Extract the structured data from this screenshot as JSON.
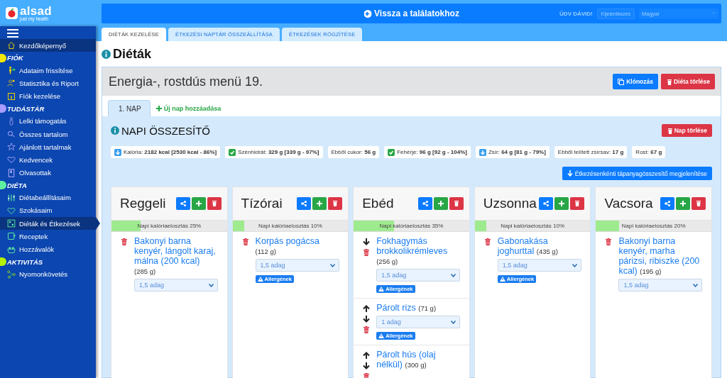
{
  "logo": {
    "name": "alsad",
    "tagline": "just my health"
  },
  "header": {
    "back_button": "Vissza a találatokhoz",
    "greeting": "ÜDV DÁVID!",
    "logout_button": "Kijelentkezés",
    "language": "Magyar"
  },
  "sidebar": {
    "items": [
      {
        "label": "Kezdőképernyő",
        "selected": false,
        "hover": true
      }
    ],
    "sections": [
      {
        "title": "FIÓK",
        "color": "#f5e800",
        "items": [
          {
            "label": "Adataim frissítése",
            "selected": false
          },
          {
            "label": "Statisztika és Riport",
            "selected": false
          },
          {
            "label": "Fiók kezelése",
            "selected": false
          }
        ]
      },
      {
        "title": "TUDÁSTÁR",
        "color": "#a99cff",
        "items": [
          {
            "label": "Lelki támogatás",
            "selected": false
          },
          {
            "label": "Összes tartalom",
            "selected": false
          },
          {
            "label": "Ajánlott tartalmak",
            "selected": false
          },
          {
            "label": "Kedvencek",
            "selected": false
          },
          {
            "label": "Olvasottak",
            "selected": false
          }
        ]
      },
      {
        "title": "DIÉTA",
        "color": "#5ef0a0",
        "items": [
          {
            "label": "Diétabeállításaim",
            "selected": false
          },
          {
            "label": "Szokásaim",
            "selected": false
          },
          {
            "label": "Diéták és Étkezések",
            "selected": true
          },
          {
            "label": "Receptek",
            "selected": false
          },
          {
            "label": "Hozzávalók",
            "selected": false
          }
        ]
      },
      {
        "title": "AKTIVITÁS",
        "color": "#b4f000",
        "items": [
          {
            "label": "Nyomonkövetés",
            "selected": false
          }
        ]
      }
    ]
  },
  "tabs": [
    {
      "label": "DIÉTÁK KEZELÉSE",
      "selected": true
    },
    {
      "label": "ÉTKEZÉSI NAPTÁR ÖSSZEÁLLÍTÁSA",
      "selected": false
    },
    {
      "label": "ÉTKEZÉSEK RÖGZÍTÉSE",
      "selected": false
    }
  ],
  "page_title": "Diéták",
  "diet": {
    "title": "Energia-, rostdús menü 19.",
    "clone_button": "Klónozás",
    "delete_button": "Diéta törlése",
    "day_tabs": [
      {
        "label": "1. NAP",
        "selected": true
      }
    ],
    "add_day_link": "Új nap hozzáadása",
    "summary_title": "NAPI ÖSSZESÍTŐ",
    "delete_day_button": "Nap törlése",
    "nutrients": [
      {
        "text": "Kalória: **2182 kcal [2530 kcal - 86%]**",
        "met": false
      },
      {
        "text": "Szénhidrát: **329 g [339 g - 97%]**",
        "met": true
      },
      {
        "text": "Ebből cukor: **56 g**"
      },
      {
        "text": "Fehérje: **96 g [92 g - 104%]**",
        "met": true
      },
      {
        "text": "Zsír: **64 g [81 g - 79%]**",
        "met": false
      },
      {
        "text": "Ebből telített zsírsav: **17 g**"
      },
      {
        "text": "Rost: **67 g**"
      }
    ],
    "per_meal_button": "Étkezésenkénti tápanyagösszesítő megjelenítése",
    "meals": [
      {
        "title": "Reggeli",
        "level": 0.25,
        "distribution": "Napi kalóriaelosztás 25%",
        "items": [
          {
            "name": "Bakonyi barna kenyér, lángolt karaj, málna (200 kcal)",
            "weight": "(285 g)",
            "portion": "1,5 adag",
            "move_up": false,
            "move_down": false
          }
        ]
      },
      {
        "title": "Tízórai",
        "level": 0.1,
        "distribution": "Napi kalóriaelosztás 10%",
        "items": [
          {
            "name": "Korpás pogácsa",
            "weight": "(112 g)",
            "portion": "1,5 adag",
            "allergens": "Allergének",
            "move_up": false,
            "move_down": false
          }
        ]
      },
      {
        "title": "Ebéd",
        "level": 0.35,
        "distribution": "Napi kalóriaelosztás 35%",
        "items": [
          {
            "name": "Fokhagymás brokkolikrémleves",
            "weight": "(256 g)",
            "portion": "1,5 adag",
            "allergens": "Allergének",
            "move_up": false,
            "move_down": true
          },
          {
            "name": "Párolt rizs",
            "weight": "(71 g)",
            "portion": "1 adag",
            "allergens": "Allergének",
            "move_up": true,
            "move_down": true
          },
          {
            "name": "Párolt hús (olaj nélkül)",
            "weight": "(300 g)",
            "move_up": true,
            "move_down": true
          }
        ]
      },
      {
        "title": "Uzsonna",
        "level": 0.1,
        "distribution": "Napi kalóriaelosztás 10%",
        "items": [
          {
            "name": "Gabonakása joghurttal",
            "weight": "(435 g)",
            "portion": "1,5 adag",
            "allergens": "Allergének",
            "move_up": false,
            "move_down": false
          }
        ]
      },
      {
        "title": "Vacsora",
        "level": 0.2,
        "distribution": "Napi kalóriaelosztás 20%",
        "items": [
          {
            "name": "Bakonyi barna kenyér, marha párizsi, ribiszke (200 kcal)",
            "weight": "(195 g)",
            "portion": "1,5 adag",
            "move_up": false,
            "move_down": false
          }
        ]
      }
    ]
  }
}
